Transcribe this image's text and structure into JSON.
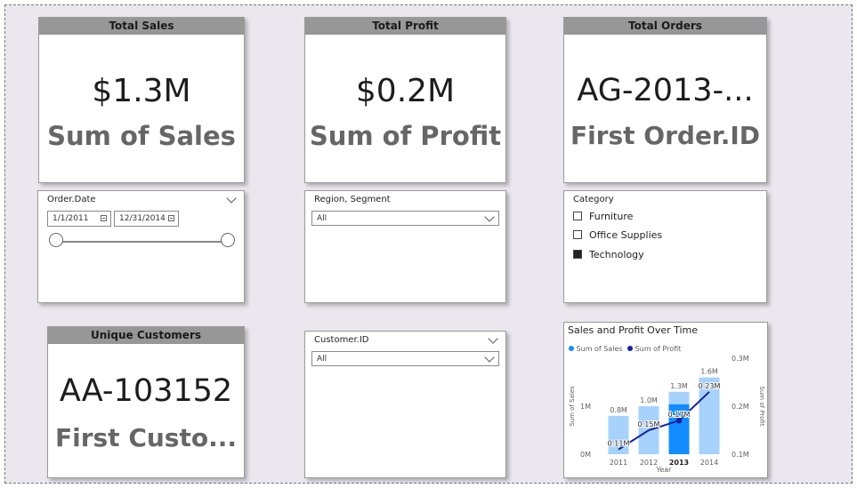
{
  "cards": {
    "sales": {
      "header": "Total Sales",
      "value": "$1.3M",
      "subtitle": "Sum of Sales"
    },
    "profit": {
      "header": "Total Profit",
      "value": "$0.2M",
      "subtitle": "Sum of Profit"
    },
    "orders": {
      "header": "Total Orders",
      "value": "AG-2013-...",
      "subtitle": "First Order.ID"
    },
    "customers": {
      "header": "Unique Customers",
      "value": "AA-103152",
      "subtitle": "First Custo..."
    }
  },
  "date_slicer": {
    "title": "Order.Date",
    "start": "1/1/2011",
    "end": "12/31/2014"
  },
  "region_slicer": {
    "title": "Region, Segment",
    "selected": "All"
  },
  "category_slicer": {
    "title": "Category",
    "items": [
      {
        "label": "Furniture",
        "checked": false
      },
      {
        "label": "Office Supplies",
        "checked": false
      },
      {
        "label": "Technology",
        "checked": true
      }
    ]
  },
  "customer_slicer": {
    "title": "Customer.ID",
    "selected": "All"
  },
  "chart_data": {
    "type": "bar",
    "title": "Sales and Profit Over Time",
    "xlabel": "Year",
    "ylabel": "Sum of Sales",
    "y2label": "Sum of Profit",
    "categories": [
      "2011",
      "2012",
      "2013",
      "2014"
    ],
    "highlighted_category": "2013",
    "series": [
      {
        "name": "Sum of Sales",
        "kind": "bar",
        "axis": "left",
        "values": [
          0.8,
          1.0,
          1.3,
          1.6
        ],
        "labels": [
          "0.8M",
          "1.0M",
          "1.3M",
          "1.6M"
        ],
        "color": "#a6d2fb",
        "highlight_color": "#118dff"
      },
      {
        "name": "Sum of Profit",
        "kind": "line",
        "axis": "right",
        "values": [
          0.11,
          0.15,
          0.17,
          0.23
        ],
        "labels": [
          "0.11M",
          "0.15M",
          "0.17M",
          "0.23M"
        ],
        "color": "#12239e"
      }
    ],
    "yticks": [
      "0M",
      "1M"
    ],
    "y2ticks": [
      "0.1M",
      "0.2M",
      "0.3M"
    ],
    "ylim": [
      0,
      2
    ],
    "y2lim": [
      0.1,
      0.3
    ],
    "legend_position": "top-left",
    "grid": false
  }
}
